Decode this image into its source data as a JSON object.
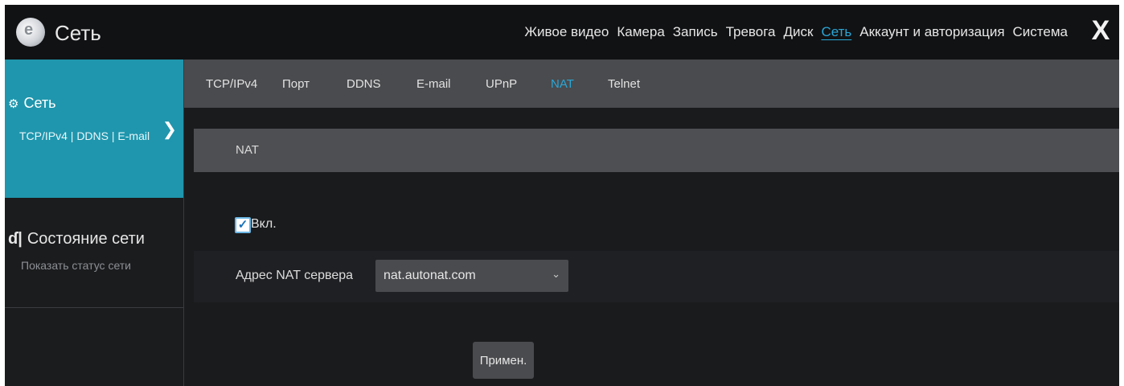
{
  "header": {
    "title": "Сеть",
    "nav": [
      "Живое видео",
      "Камера",
      "Запись",
      "Тревога",
      "Диск",
      "Сеть",
      "Аккаунт и авторизация",
      "Система"
    ],
    "active_nav": "Сеть",
    "close_label": "X"
  },
  "sidebar": {
    "network": {
      "title": "Сеть",
      "links": "TCP/IPv4 | DDNS | E-mail",
      "chevron": "❯"
    },
    "status": {
      "title": "Состояние сети",
      "subtitle": "Показать статус сети"
    }
  },
  "tabs": [
    "TCP/IPv4",
    "Порт",
    "DDNS",
    "E-mail",
    "UPnP",
    "NAT",
    "Telnet"
  ],
  "active_tab": "NAT",
  "section": {
    "title": "NAT"
  },
  "form": {
    "enable_label": "Вкл.",
    "enable_checked": true,
    "server_label": "Адрес NAT сервера",
    "server_value": "nat.autonat.com",
    "select_arrow": "⌄"
  },
  "apply_label": "Примен.",
  "colors": {
    "accent": "#2aa6d6",
    "sidebar_active": "#1f96ad",
    "background": "#1a1b1d"
  }
}
